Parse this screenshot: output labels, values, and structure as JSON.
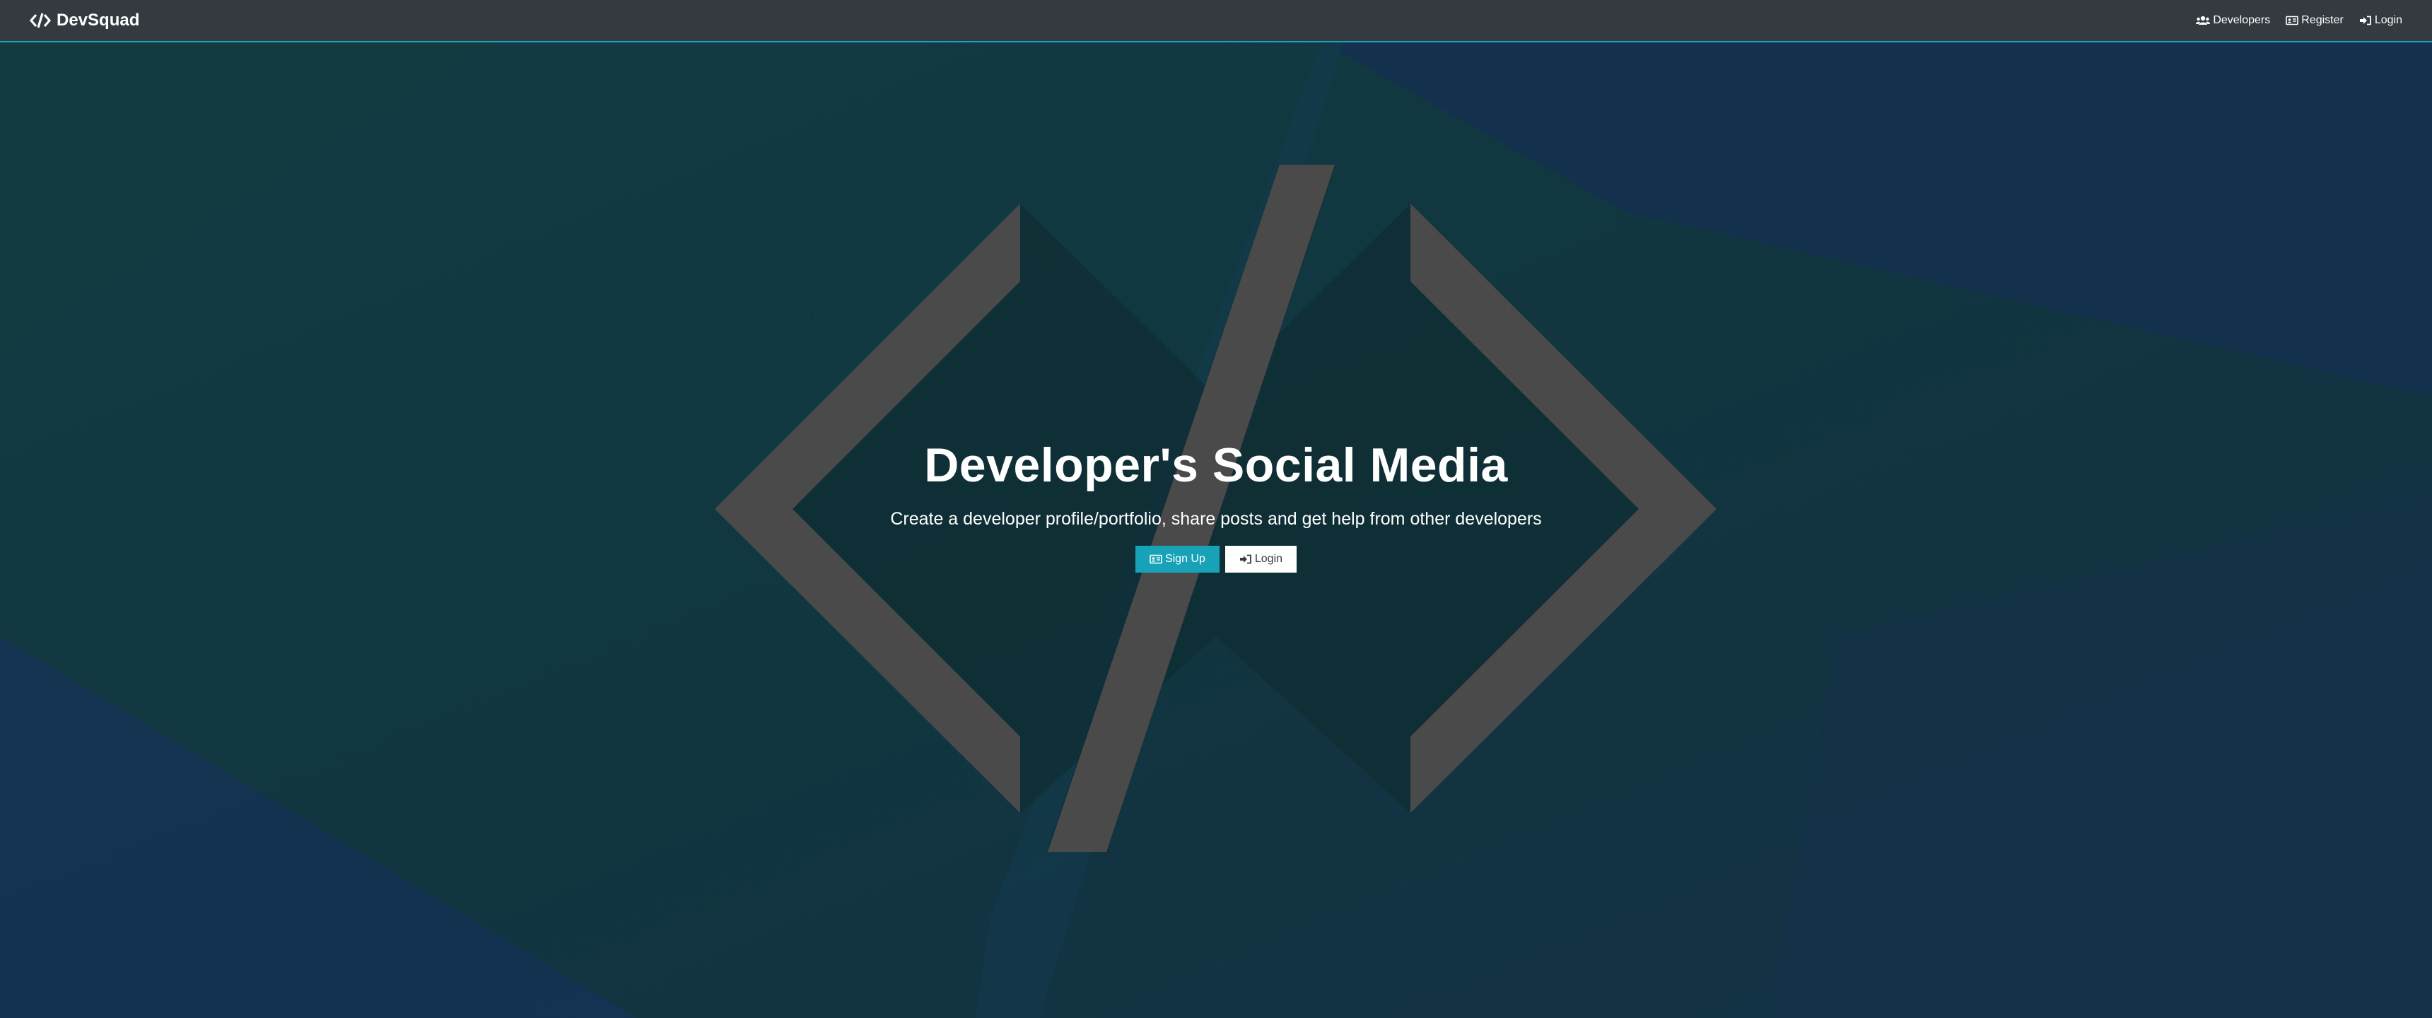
{
  "navbar": {
    "brand": "DevSquad",
    "links": [
      {
        "label": "Developers",
        "icon": "users-icon"
      },
      {
        "label": "Register",
        "icon": "id-card-icon"
      },
      {
        "label": "Login",
        "icon": "sign-in-icon"
      }
    ]
  },
  "landing": {
    "title": "Developer's Social Media",
    "lead": "Create a developer profile/portfolio, share posts and get help from other developers",
    "signup_label": "Sign Up",
    "login_label": "Login"
  },
  "colors": {
    "navbar_bg": "#343a40",
    "accent_info": "#17a2b8",
    "background_teal": "#12394a",
    "background_blue": "#15305a",
    "code_symbol_gray": "#4a4a4a"
  }
}
